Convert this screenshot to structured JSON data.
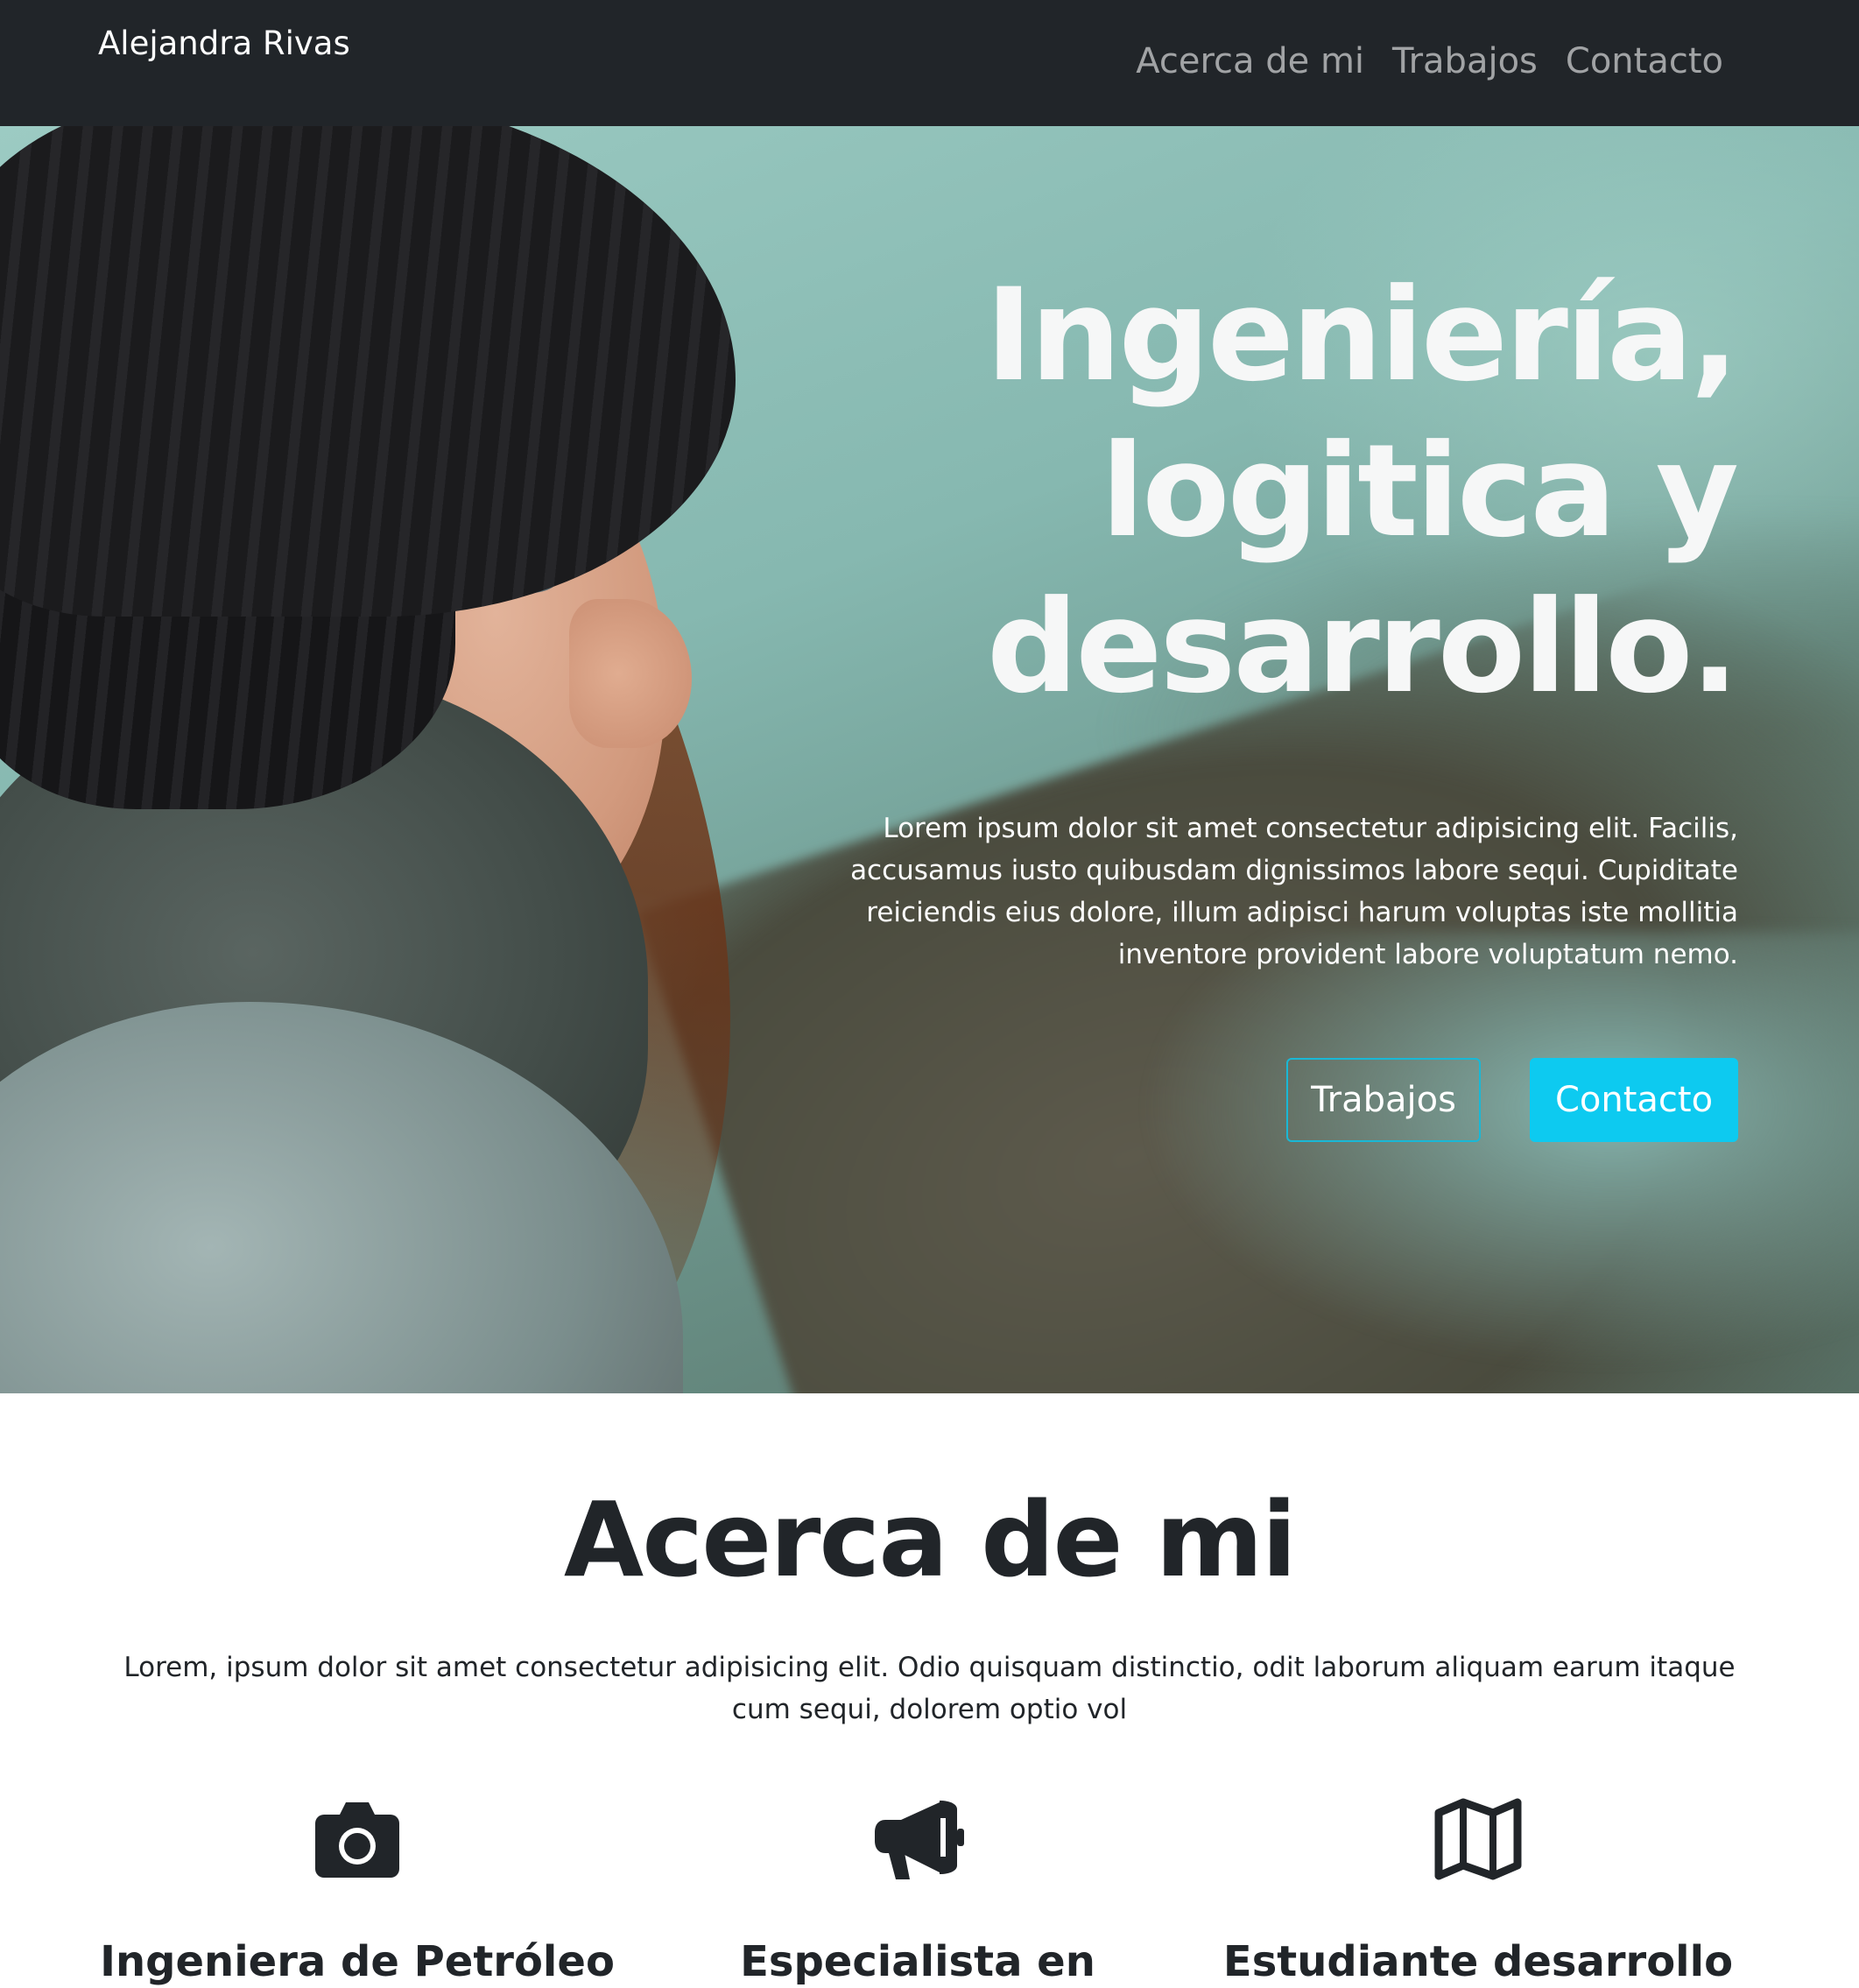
{
  "navbar": {
    "brand": "Alejandra Rivas",
    "links": [
      "Acerca de mi",
      "Trabajos",
      "Contacto"
    ]
  },
  "hero": {
    "title": "Ingeniería, logitica y desarrollo.",
    "text": "Lorem ipsum dolor sit amet consectetur adipisicing elit. Facilis, accusamus iusto quibusdam dignissimos labore sequi. Cupiditate reiciendis eius dolore, illum adipisci harum voluptas iste mollitia inventore provident labore voluptatum nemo.",
    "buttons": {
      "secondary": "Trabajos",
      "primary": "Contacto"
    }
  },
  "about": {
    "title": "Acerca de mi",
    "text": "Lorem, ipsum dolor sit amet consectetur adipisicing elit. Odio quisquam distinctio, odit laborum aliquam earum itaque cum sequi, dolorem optio vol",
    "features": [
      {
        "icon": "camera-icon",
        "title": "Ingeniera de Petróleo"
      },
      {
        "icon": "megaphone-icon",
        "title": "Especialista en"
      },
      {
        "icon": "map-icon",
        "title": "Estudiante desarrollo"
      }
    ]
  },
  "colors": {
    "navbar_bg": "#212529",
    "accent": "#0dcaf0",
    "text_dark": "#212529"
  }
}
